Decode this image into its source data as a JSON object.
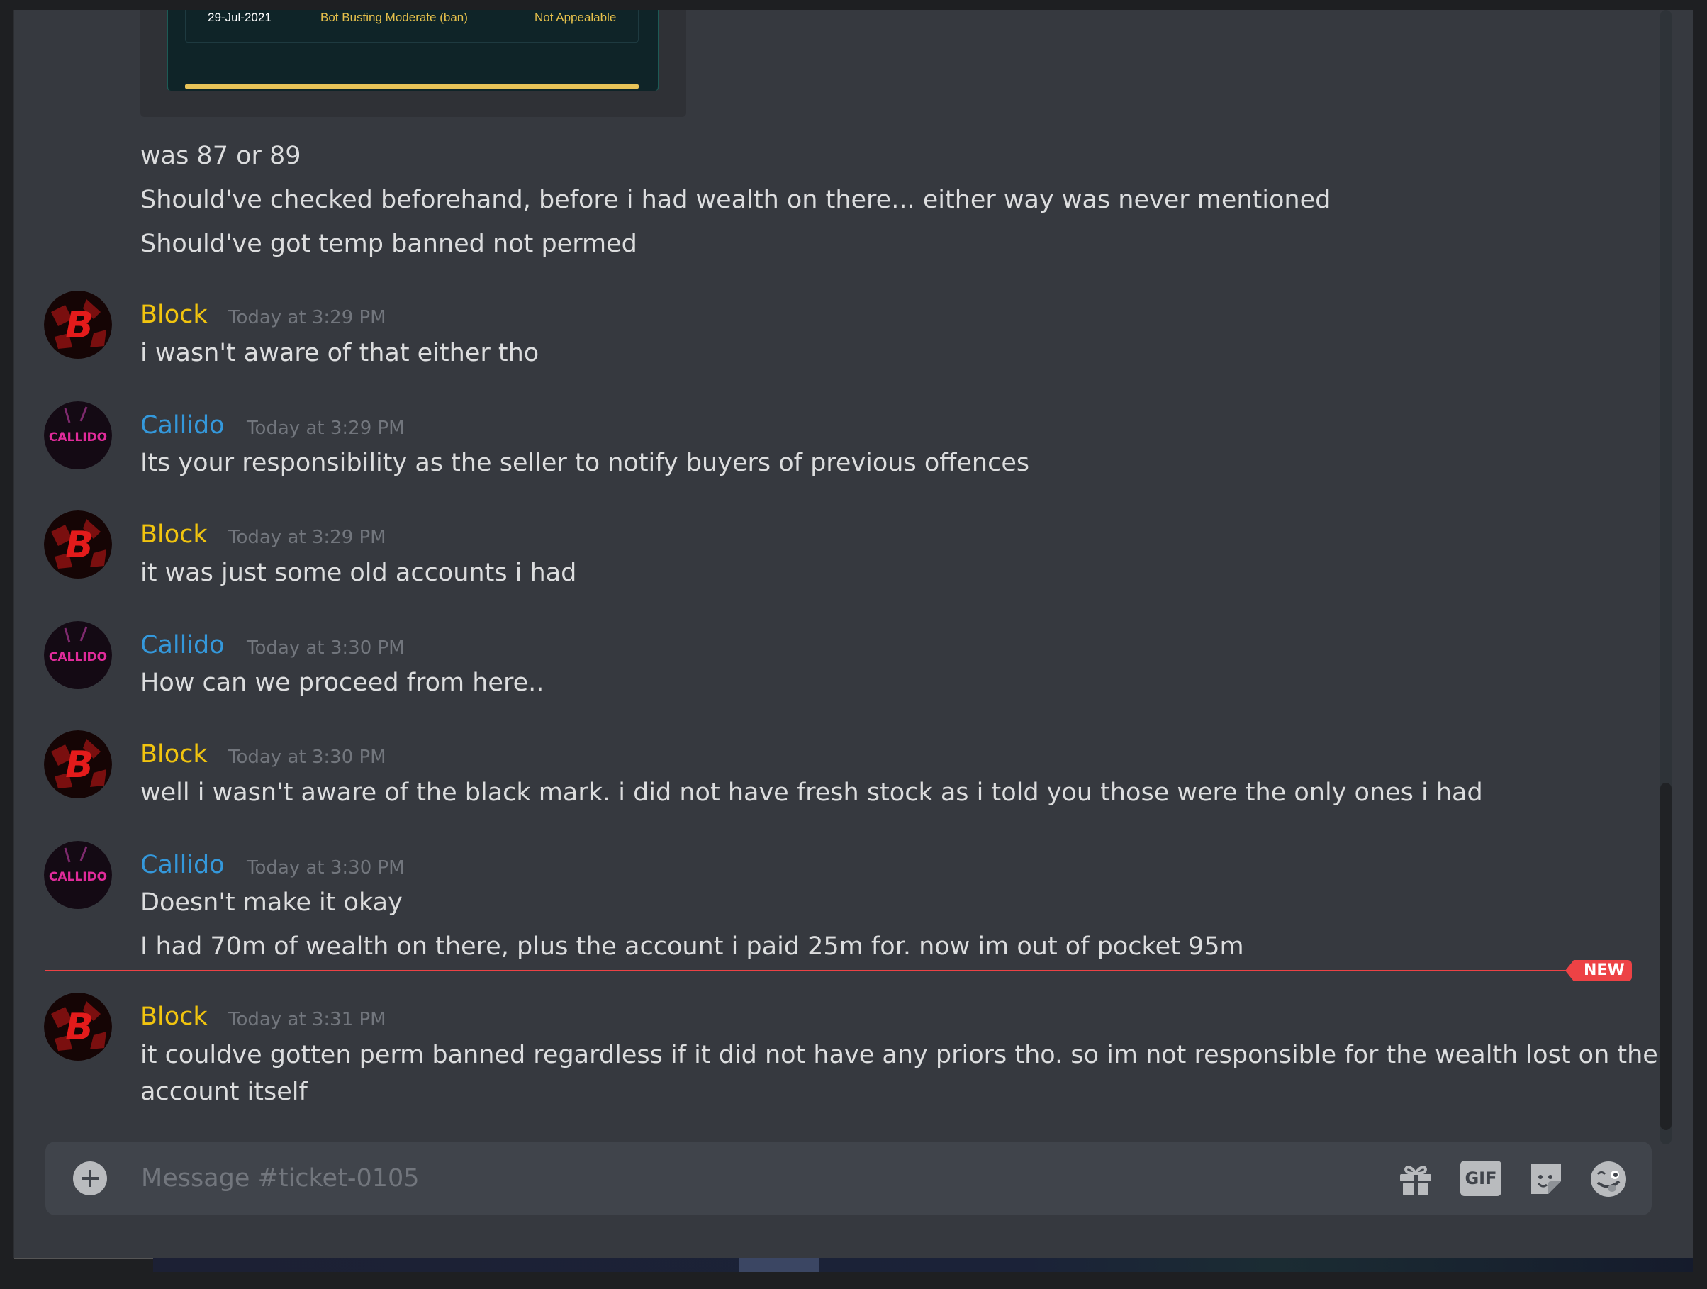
{
  "embed": {
    "date": "29-Jul-2021",
    "offence": "Bot Busting Moderate (ban)",
    "appeal": "Not Appealable"
  },
  "continuation": [
    "was 87 or 89",
    "Should've checked beforehand, before i had wealth on there... either way was never mentioned",
    "Should've got temp banned not permed"
  ],
  "messages": [
    {
      "author": "Block",
      "time": "Today at 3:29 PM",
      "lines": [
        "i wasn't aware of that either tho"
      ]
    },
    {
      "author": "Callido",
      "time": "Today at 3:29 PM",
      "lines": [
        "Its your responsibility as the seller to notify buyers of previous offences"
      ]
    },
    {
      "author": "Block",
      "time": "Today at 3:29 PM",
      "lines": [
        "it was just some old accounts i had"
      ]
    },
    {
      "author": "Callido",
      "time": "Today at 3:30 PM",
      "lines": [
        "How can we proceed from here.."
      ]
    },
    {
      "author": "Block",
      "time": "Today at 3:30 PM",
      "lines": [
        "well i wasn't aware of the black mark. i did not have fresh stock as i told you those were the only ones i had"
      ]
    },
    {
      "author": "Callido",
      "time": "Today at 3:30 PM",
      "lines": [
        "Doesn't make it okay",
        "I had 70m of wealth on there, plus the account i paid 25m for. now im out of pocket 95m"
      ]
    },
    {
      "author": "Block",
      "time": "Today at 3:31 PM",
      "lines": [
        "it couldve gotten perm banned regardless if it did not have any priors tho. so im not responsible for the wealth lost on the",
        "account itself"
      ]
    }
  ],
  "new_badge": "NEW",
  "composer": {
    "placeholder": "Message #ticket-0105",
    "gif_label": "GIF"
  },
  "avatar_text": {
    "block": "B",
    "callido": "CALLIDO"
  },
  "colors": {
    "block_name": "#f1c40f",
    "callido_name": "#3498db",
    "new_divider": "#ed4245"
  },
  "icons": [
    "add-attachment-icon",
    "gift-icon",
    "gif-icon",
    "sticker-icon",
    "emoji-icon"
  ]
}
